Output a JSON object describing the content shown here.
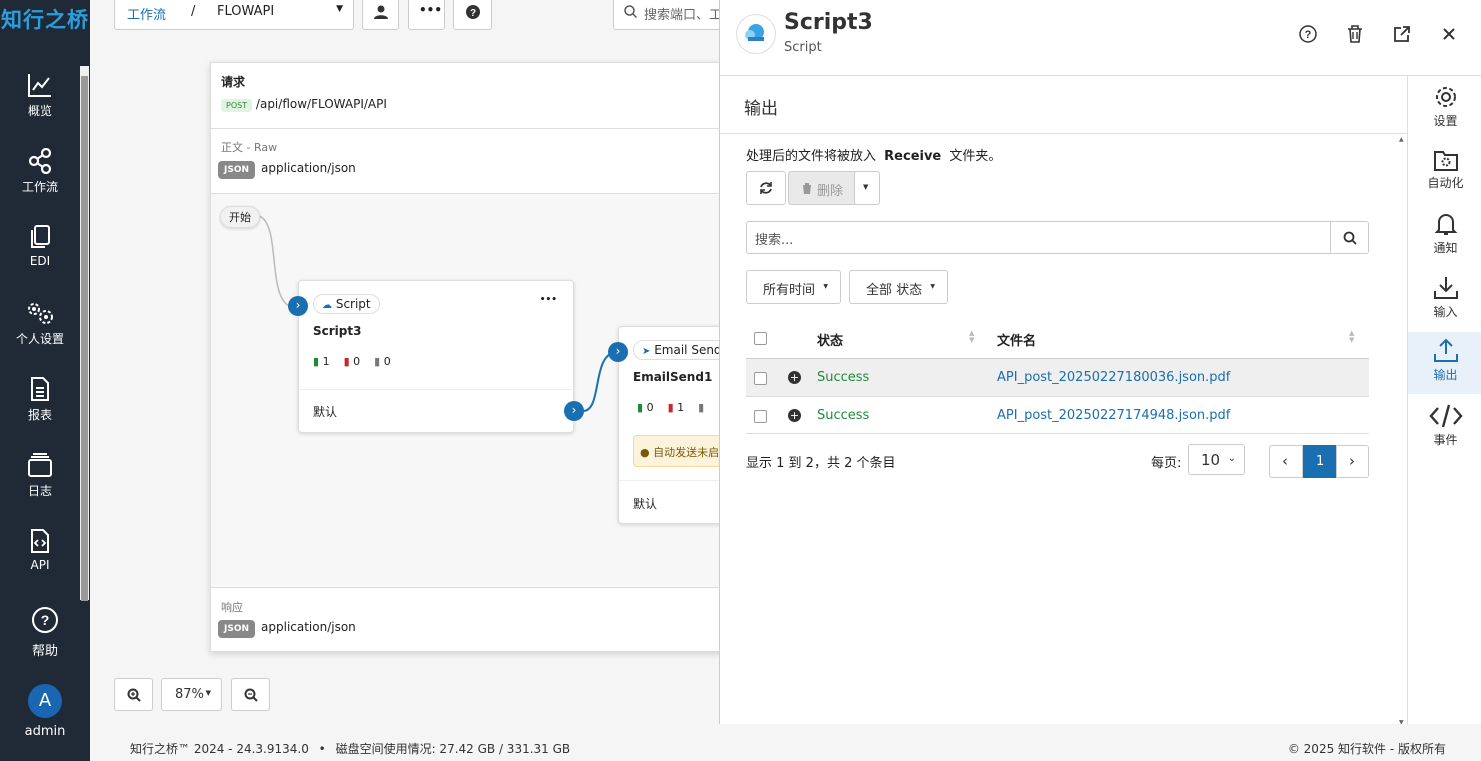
{
  "app": {
    "logo": "知行之桥"
  },
  "sidebar": {
    "items": [
      {
        "label": "概览",
        "icon": "chart-line-icon"
      },
      {
        "label": "工作流",
        "icon": "flow-nodes-icon"
      },
      {
        "label": "EDI",
        "icon": "copy-icon"
      },
      {
        "label": "个人设置",
        "icon": "gears-icon"
      },
      {
        "label": "报表",
        "icon": "document-icon"
      },
      {
        "label": "日志",
        "icon": "layers-icon"
      },
      {
        "label": "API",
        "icon": "code-file-icon"
      }
    ],
    "help": "帮助",
    "user_initial": "A",
    "user_name": "admin"
  },
  "topbar": {
    "breadcrumb_root": "工作流",
    "breadcrumb_sep": "/",
    "breadcrumb_current": "FLOWAPI",
    "search_placeholder": "搜索端口、工"
  },
  "flow": {
    "request_title": "请求",
    "method": "POST",
    "path": "/api/flow/FLOWAPI/API",
    "body_label": "正文 - Raw",
    "body_type_tag": "JSON",
    "body_type": "application/json",
    "start": "开始",
    "response_label": "响应",
    "response_type_tag": "JSON",
    "response_type": "application/json",
    "nodes": [
      {
        "type": "Script",
        "name": "Script3",
        "counts": [
          "1",
          "0",
          "0"
        ],
        "default": "默认",
        "menu": "•••"
      },
      {
        "type": "Email Send",
        "name": "EmailSend1",
        "counts": [
          "0",
          "1",
          ""
        ],
        "warning": "自动发送未启",
        "default": "默认"
      }
    ],
    "zoom": "87%"
  },
  "panel": {
    "title": "Script3",
    "subtitle": "Script",
    "section": "输出",
    "info_prefix": "处理后的文件将被放入",
    "info_folder": "Receive",
    "info_suffix": "文件夹。",
    "delete_label": "删除",
    "search_placeholder": "搜索...",
    "filter_time": "所有时间",
    "filter_status": "全部 状态",
    "columns": [
      "状态",
      "文件名"
    ],
    "rows": [
      {
        "status": "Success",
        "file": "API_post_20250227180036.json.pdf"
      },
      {
        "status": "Success",
        "file": "API_post_20250227174948.json.pdf"
      }
    ],
    "summary": "显示 1 到 2，共 2 个条目",
    "per_page_label": "每页:",
    "per_page": "10",
    "current_page": "1"
  },
  "right_tabs": [
    {
      "label": "设置",
      "icon": "gear-icon"
    },
    {
      "label": "自动化",
      "icon": "folder-gear-icon"
    },
    {
      "label": "通知",
      "icon": "bell-icon"
    },
    {
      "label": "输入",
      "icon": "download-icon"
    },
    {
      "label": "输出",
      "icon": "upload-icon",
      "active": true
    },
    {
      "label": "事件",
      "icon": "code-icon"
    }
  ],
  "footer": {
    "version": "知行之桥™ 2024 - 24.3.9134.0",
    "disk": "磁盘空间使用情况:  27.42 GB / 331.31 GB",
    "copyright": "© 2025 知行软件 - 版权所有"
  },
  "colors": {
    "sidebar": "#1f2a36",
    "accent": "#1a6fb0",
    "success": "#1f8a3a"
  }
}
